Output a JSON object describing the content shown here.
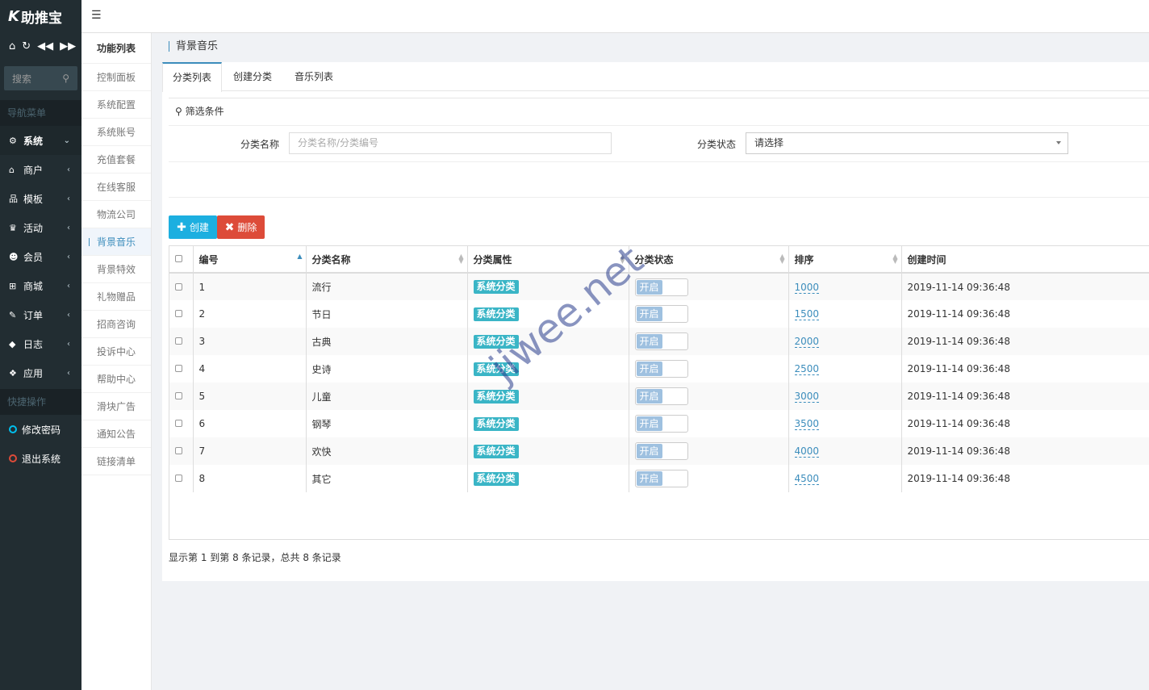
{
  "app": {
    "logo_k": "K",
    "logo_text": "助推宝"
  },
  "sidebar": {
    "search_label": "搜索",
    "nav_header": "导航菜单",
    "items": [
      {
        "label": "系统",
        "icon": "gear-icon",
        "glyph": "⚙",
        "active": true,
        "chevron": "⌄"
      },
      {
        "label": "商户",
        "icon": "home-icon",
        "glyph": "⌂",
        "chevron": "‹"
      },
      {
        "label": "模板",
        "icon": "sitemap-icon",
        "glyph": "品",
        "chevron": "‹"
      },
      {
        "label": "活动",
        "icon": "trophy-icon",
        "glyph": "♛",
        "chevron": "‹"
      },
      {
        "label": "会员",
        "icon": "users-icon",
        "glyph": "☻",
        "chevron": "‹"
      },
      {
        "label": "商城",
        "icon": "cart-icon",
        "glyph": "⊞",
        "chevron": "‹"
      },
      {
        "label": "订单",
        "icon": "gavel-icon",
        "glyph": "✎",
        "chevron": "‹"
      },
      {
        "label": "日志",
        "icon": "shield-icon",
        "glyph": "◆",
        "chevron": "‹"
      },
      {
        "label": "应用",
        "icon": "cubes-icon",
        "glyph": "❖",
        "chevron": "‹"
      }
    ],
    "quick_header": "快捷操作",
    "change_password": "修改密码",
    "logout": "退出系统"
  },
  "subnav": {
    "title": "功能列表",
    "items": [
      "控制面板",
      "系统配置",
      "系统账号",
      "充值套餐",
      "在线客服",
      "物流公司",
      "背景音乐",
      "背景特效",
      "礼物赠品",
      "招商咨询",
      "投诉中心",
      "帮助中心",
      "滑块广告",
      "通知公告",
      "链接清单"
    ],
    "active_index": 6
  },
  "page": {
    "title": "背景音乐",
    "tabs": [
      "分类列表",
      "创建分类",
      "音乐列表"
    ],
    "active_tab": 0
  },
  "filter": {
    "head": "筛选条件",
    "name_label": "分类名称",
    "name_placeholder": "分类名称/分类编号",
    "status_label": "分类状态",
    "status_value": "请选择"
  },
  "buttons": {
    "create": "创建",
    "delete": "删除"
  },
  "table": {
    "headers": [
      "编号",
      "分类名称",
      "分类属性",
      "分类状态",
      "排序",
      "创建时间"
    ],
    "rows": [
      {
        "id": "1",
        "name": "流行",
        "attr": "系统分类",
        "status": "开启",
        "sort": "1000",
        "created": "2019-11-14 09:36:48"
      },
      {
        "id": "2",
        "name": "节日",
        "attr": "系统分类",
        "status": "开启",
        "sort": "1500",
        "created": "2019-11-14 09:36:48"
      },
      {
        "id": "3",
        "name": "古典",
        "attr": "系统分类",
        "status": "开启",
        "sort": "2000",
        "created": "2019-11-14 09:36:48"
      },
      {
        "id": "4",
        "name": "史诗",
        "attr": "系统分类",
        "status": "开启",
        "sort": "2500",
        "created": "2019-11-14 09:36:48"
      },
      {
        "id": "5",
        "name": "儿童",
        "attr": "系统分类",
        "status": "开启",
        "sort": "3000",
        "created": "2019-11-14 09:36:48"
      },
      {
        "id": "6",
        "name": "钢琴",
        "attr": "系统分类",
        "status": "开启",
        "sort": "3500",
        "created": "2019-11-14 09:36:48"
      },
      {
        "id": "7",
        "name": "欢快",
        "attr": "系统分类",
        "status": "开启",
        "sort": "4000",
        "created": "2019-11-14 09:36:48"
      },
      {
        "id": "8",
        "name": "其它",
        "attr": "系统分类",
        "status": "开启",
        "sort": "4500",
        "created": "2019-11-14 09:36:48"
      }
    ]
  },
  "summary": "显示第 1 到第 8 条记录，总共 8 条记录",
  "watermark": "jiwee.net"
}
